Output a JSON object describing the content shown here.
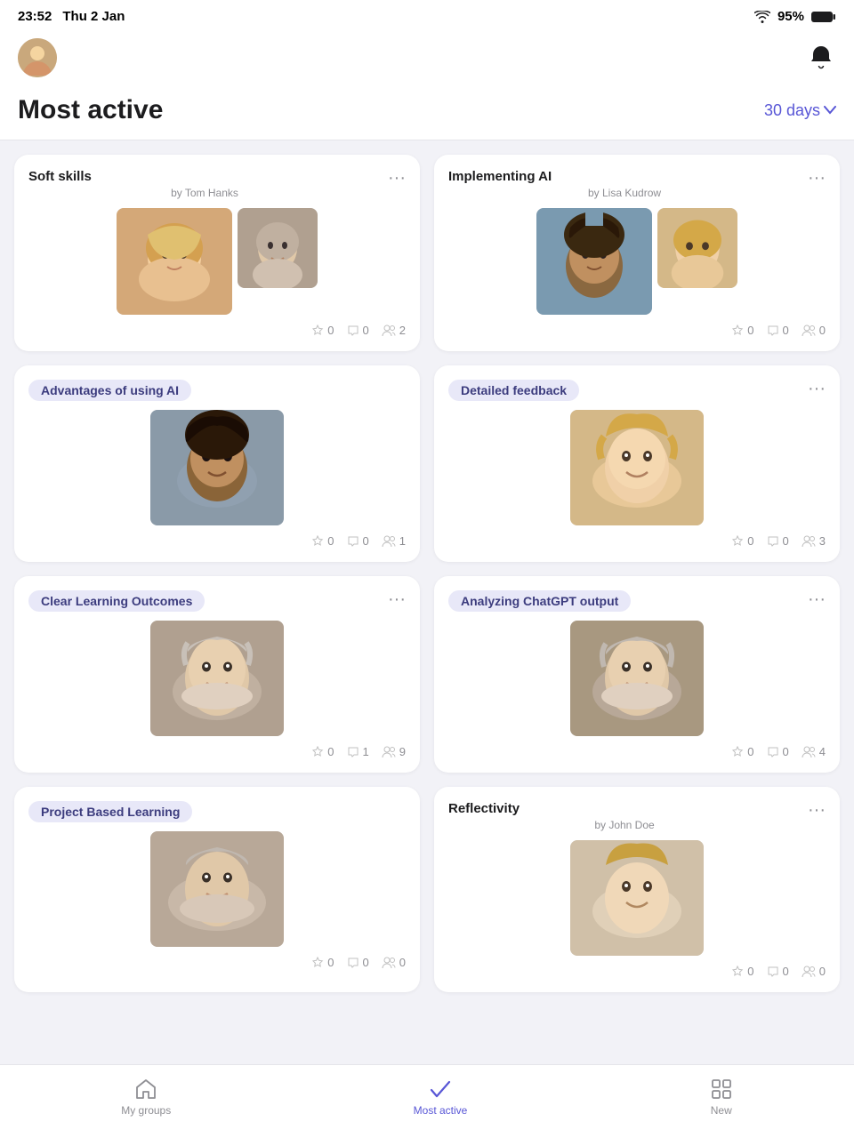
{
  "statusBar": {
    "time": "23:52",
    "date": "Thu 2 Jan",
    "battery": "95%",
    "wifiIcon": "wifi",
    "batteryIcon": "battery"
  },
  "header": {
    "avatarAlt": "User avatar",
    "bellIcon": "bell"
  },
  "pageTitle": "Most active",
  "filterLabel": "30 days",
  "filterIcon": "chevron-down",
  "cards": [
    {
      "id": 1,
      "title": "Soft skills",
      "hasBadge": false,
      "subtitle": "by Tom Hanks",
      "images": [
        "woman-blonde",
        "man-gray"
      ],
      "stars": 0,
      "comments": 0,
      "members": 2,
      "hasMore": true
    },
    {
      "id": 2,
      "title": "Implementing AI",
      "hasBadge": false,
      "subtitle": "by Lisa Kudrow",
      "images": [
        "man-curly",
        "woman-blonde2"
      ],
      "stars": 0,
      "comments": 0,
      "members": 0,
      "hasMore": true
    },
    {
      "id": 3,
      "title": "Advantages of using AI",
      "hasBadge": true,
      "subtitle": "",
      "images": [
        "man-curly2"
      ],
      "stars": 0,
      "comments": 0,
      "members": 1,
      "hasMore": false
    },
    {
      "id": 4,
      "title": "Detailed feedback",
      "hasBadge": true,
      "subtitle": "",
      "images": [
        "woman-smile"
      ],
      "stars": 0,
      "comments": 0,
      "members": 3,
      "hasMore": true
    },
    {
      "id": 5,
      "title": "Clear Learning Outcomes",
      "hasBadge": true,
      "subtitle": "",
      "images": [
        "man-older"
      ],
      "stars": 0,
      "comments": 1,
      "members": 9,
      "hasMore": true
    },
    {
      "id": 6,
      "title": "Analyzing ChatGPT output",
      "hasBadge": true,
      "subtitle": "",
      "images": [
        "man-older2"
      ],
      "stars": 0,
      "comments": 0,
      "members": 4,
      "hasMore": true
    },
    {
      "id": 7,
      "title": "Project Based Learning",
      "hasBadge": true,
      "subtitle": "",
      "images": [
        "man-older3"
      ],
      "stars": 0,
      "comments": 0,
      "members": 0,
      "hasMore": false
    },
    {
      "id": 8,
      "title": "Reflectivity",
      "hasBadge": false,
      "subtitle": "by John Doe",
      "images": [
        "woman-smile2"
      ],
      "stars": 0,
      "comments": 0,
      "members": 0,
      "hasMore": true
    }
  ],
  "bottomNav": {
    "items": [
      {
        "id": "my-groups",
        "label": "My groups",
        "icon": "home",
        "active": false
      },
      {
        "id": "most-active",
        "label": "Most active",
        "icon": "checkmark",
        "active": true
      },
      {
        "id": "new",
        "label": "New",
        "icon": "grid",
        "active": false
      }
    ]
  }
}
